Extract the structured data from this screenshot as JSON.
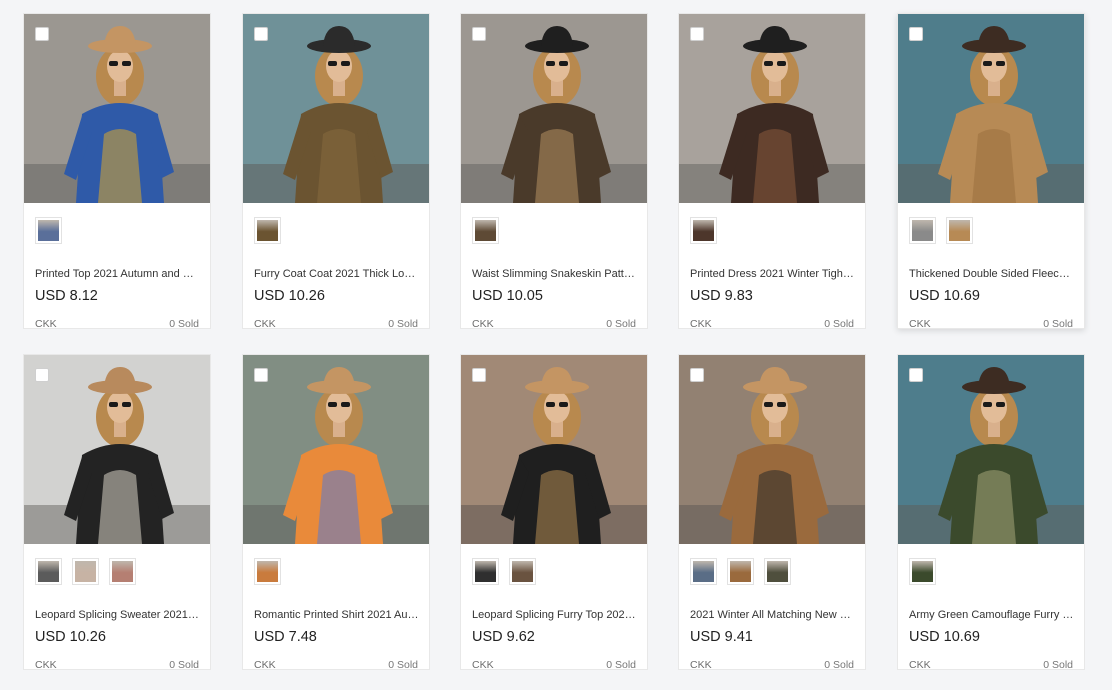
{
  "products": [
    {
      "title": "Printed Top 2021 Autumn and …",
      "price": "USD 8.12",
      "shop": "CKK",
      "sold": "0 Sold",
      "bg": "#8d8a86",
      "wall": "#a7a29a",
      "outfit": "#2f5aa8",
      "accent": "#d9a72c",
      "hat": "#c49563",
      "thumbs": [
        "#5a6f9a"
      ]
    },
    {
      "title": "Furry Coat Coat 2021 Thick Loo…",
      "price": "USD 10.26",
      "shop": "CKK",
      "sold": "0 Sold",
      "bg": "#5c7e87",
      "wall": "#7fa0a6",
      "outfit": "#6b5431",
      "accent": "#876a3e",
      "hat": "#2b2b2b",
      "thumbs": [
        "#6b5431"
      ]
    },
    {
      "title": "Waist Slimming Snakeskin Patte…",
      "price": "USD 10.05",
      "shop": "CKK",
      "sold": "0 Sold",
      "bg": "#8e8b86",
      "wall": "#a8a39b",
      "outfit": "#4a3a2a",
      "accent": "#b59061",
      "hat": "#1f1f1f",
      "thumbs": [
        "#5e4a35"
      ]
    },
    {
      "title": "Printed Dress 2021 Winter Tight…",
      "price": "USD 9.83",
      "shop": "CKK",
      "sold": "0 Sold",
      "bg": "#9a9690",
      "wall": "#b4ada5",
      "outfit": "#3d2a22",
      "accent": "#8a5a3d",
      "hat": "#1f1f1f",
      "thumbs": [
        "#4d362b"
      ]
    },
    {
      "title": "Thickened Double Sided Fleece …",
      "price": "USD 10.69",
      "shop": "CKK",
      "sold": "0 Sold",
      "bg": "#3d6c7a",
      "wall": "#5f8d99",
      "outfit": "#b78a55",
      "accent": "#9a6f3e",
      "hat": "#3d2c22",
      "thumbs": [
        "#8a8a8a",
        "#b78a55"
      ]
    },
    {
      "title": "Leopard Splicing Sweater 2021 …",
      "price": "USD 10.26",
      "shop": "CKK",
      "sold": "0 Sold",
      "bg": "#c8c8c6",
      "wall": "#dadad8",
      "outfit": "#232323",
      "accent": "#d8d3c6",
      "hat": "#b88a5d",
      "thumbs": [
        "#5b5b5b",
        "#c7b3a4",
        "#b57f72"
      ]
    },
    {
      "title": "Romantic Printed Shirt 2021 Au…",
      "price": "USD 7.48",
      "shop": "CKK",
      "sold": "0 Sold",
      "bg": "#6f7f74",
      "wall": "#8f9b90",
      "outfit": "#e98a3a",
      "accent": "#5a7ad0",
      "hat": "#c49563",
      "thumbs": [
        "#c97b3d"
      ]
    },
    {
      "title": "Leopard Splicing Furry Top 202…",
      "price": "USD 9.62",
      "shop": "CKK",
      "sold": "0 Sold",
      "bg": "#8a6d5a",
      "wall": "#b4a18e",
      "outfit": "#1f1f1f",
      "accent": "#b28a52",
      "hat": "#c49563",
      "thumbs": [
        "#2f2f2f",
        "#6a5340"
      ]
    },
    {
      "title": "2021 Winter All Matching New …",
      "price": "USD 9.41",
      "shop": "CKK",
      "sold": "0 Sold",
      "bg": "#7e6a5c",
      "wall": "#a39385",
      "outfit": "#9a6a3d",
      "accent": "#2a2a2a",
      "hat": "#c49563",
      "thumbs": [
        "#5a6d86",
        "#9a6a3d",
        "#4f4f3d"
      ]
    },
    {
      "title": "Army Green Camouflage Furry …",
      "price": "USD 10.69",
      "shop": "CKK",
      "sold": "0 Sold",
      "bg": "#3d6c7a",
      "wall": "#5d8d9a",
      "outfit": "#3b4a2c",
      "accent": "#a6a67a",
      "hat": "#3d2c22",
      "thumbs": [
        "#3b4a2c"
      ]
    }
  ]
}
